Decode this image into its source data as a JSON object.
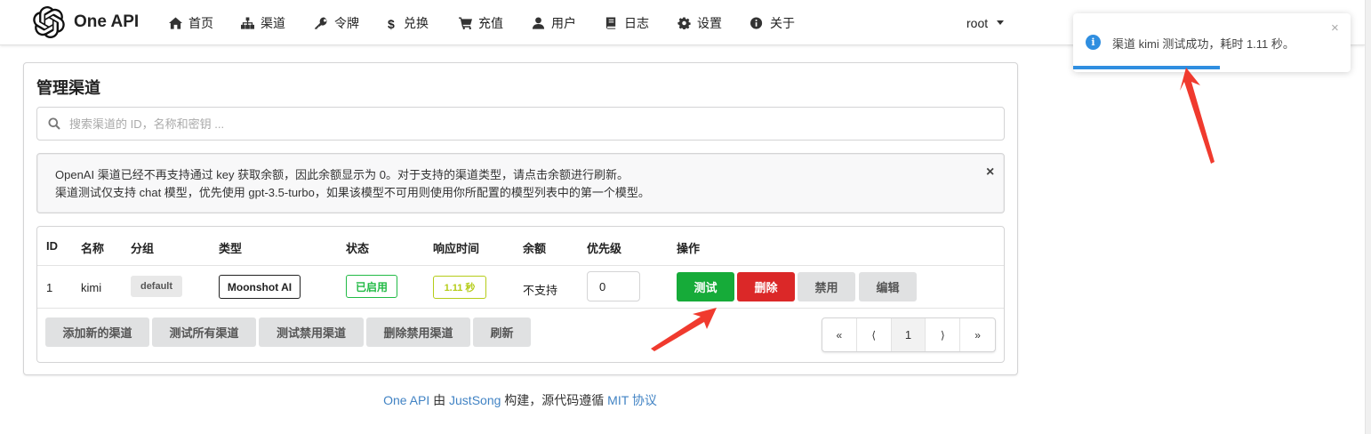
{
  "app": {
    "brand": "One API"
  },
  "nav": [
    {
      "icon": "home-icon",
      "label": "首页"
    },
    {
      "icon": "sitemap-icon",
      "label": "渠道"
    },
    {
      "icon": "key-icon",
      "label": "令牌"
    },
    {
      "icon": "dollar-icon",
      "label": "兑换"
    },
    {
      "icon": "cart-icon",
      "label": "充值"
    },
    {
      "icon": "user-icon",
      "label": "用户"
    },
    {
      "icon": "book-icon",
      "label": "日志"
    },
    {
      "icon": "gear-icon",
      "label": "设置"
    },
    {
      "icon": "info-icon",
      "label": "关于"
    }
  ],
  "user": {
    "name": "root"
  },
  "page": {
    "title": "管理渠道",
    "search_placeholder": "搜索渠道的 ID，名称和密钥 ...",
    "notice": {
      "line1": "OpenAI 渠道已经不再支持通过 key 获取余额，因此余额显示为 0。对于支持的渠道类型，请点击余额进行刷新。",
      "line2": "渠道测试仅支持 chat 模型，优先使用 gpt-3.5-turbo，如果该模型不可用则使用你所配置的模型列表中的第一个模型。",
      "close": "×"
    }
  },
  "table": {
    "headers": [
      "ID",
      "名称",
      "分组",
      "类型",
      "状态",
      "响应时间",
      "余额",
      "优先级",
      "操作"
    ],
    "rows": [
      {
        "id": "1",
        "name": "kimi",
        "group": "default",
        "type": "Moonshot AI",
        "status": "已启用",
        "response_time": "1.11 秒",
        "balance": "不支持",
        "priority": "0",
        "actions": {
          "test": "测试",
          "delete": "删除",
          "disable": "禁用",
          "edit": "编辑"
        }
      }
    ],
    "footer_buttons": [
      "添加新的渠道",
      "测试所有渠道",
      "测试禁用渠道",
      "删除禁用渠道",
      "刷新"
    ],
    "pagination": {
      "first": "«",
      "prev": "⟨",
      "current": "1",
      "next": "⟩",
      "last": "»"
    }
  },
  "footer": {
    "link1": "One API",
    "text1": " 由 ",
    "link2": "JustSong",
    "text2": " 构建，源代码遵循 ",
    "link3": "MIT 协议"
  },
  "toast": {
    "message": "渠道 kimi 测试成功，耗时 1.11 秒。",
    "close": "×",
    "progress": 0.53
  },
  "colors": {
    "test_button": "#16ab39",
    "delete_button": "#db2828",
    "status_enabled": "#21ba45",
    "response_time": "#b5cc18",
    "toast_accent": "#2f8ee0",
    "annotation_arrow": "#f03a2e"
  }
}
